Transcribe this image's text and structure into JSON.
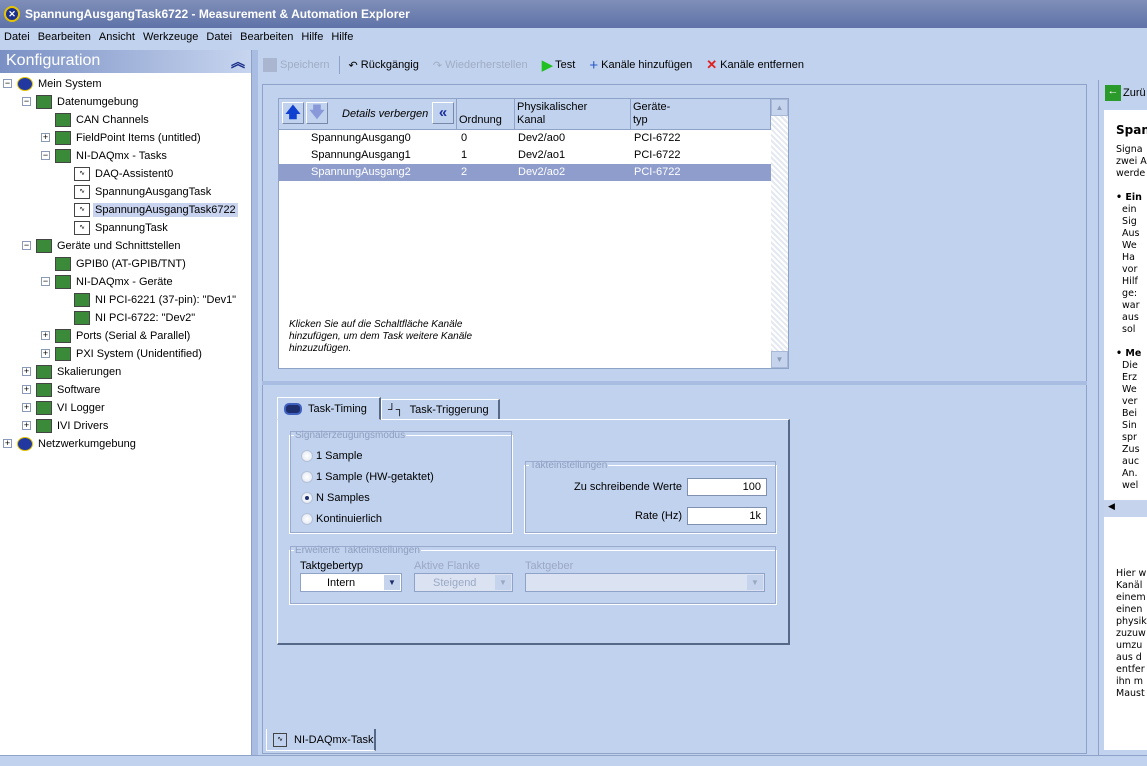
{
  "window": {
    "title": "SpannungAusgangTask6722 - Measurement & Automation Explorer"
  },
  "menu": [
    "Datei",
    "Bearbeiten",
    "Ansicht",
    "Werkzeuge",
    "Datei",
    "Bearbeiten",
    "Hilfe",
    "Hilfe"
  ],
  "left": {
    "title": "Konfiguration",
    "tree": [
      {
        "label": "Mein System",
        "level": 0,
        "exp": "-",
        "icon": "computer-icon"
      },
      {
        "label": "Datenumgebung",
        "level": 1,
        "exp": "-",
        "icon": "data-neighborhood-icon"
      },
      {
        "label": "CAN Channels",
        "level": 2,
        "exp": "",
        "icon": "can-icon"
      },
      {
        "label": "FieldPoint Items (untitled)",
        "level": 2,
        "exp": "+",
        "icon": "fieldpoint-icon"
      },
      {
        "label": "NI-DAQmx - Tasks",
        "level": 2,
        "exp": "-",
        "icon": "tasks-folder-icon"
      },
      {
        "label": "DAQ-Assistent0",
        "level": 3,
        "exp": "",
        "icon": "task-icon"
      },
      {
        "label": "SpannungAusgangTask",
        "level": 3,
        "exp": "",
        "icon": "task-icon"
      },
      {
        "label": "SpannungAusgangTask6722",
        "level": 3,
        "exp": "",
        "icon": "task-icon",
        "selected": true
      },
      {
        "label": "SpannungTask",
        "level": 3,
        "exp": "",
        "icon": "task-icon"
      },
      {
        "label": "Geräte und Schnittstellen",
        "level": 1,
        "exp": "-",
        "icon": "devices-icon"
      },
      {
        "label": "GPIB0 (AT-GPIB/TNT)",
        "level": 2,
        "exp": "",
        "icon": "gpib-icon"
      },
      {
        "label": "NI-DAQmx - Geräte",
        "level": 2,
        "exp": "-",
        "icon": "daq-devices-icon"
      },
      {
        "label": "NI PCI-6221 (37-pin): \"Dev1\"",
        "level": 3,
        "exp": "",
        "icon": "device-icon"
      },
      {
        "label": "NI PCI-6722: \"Dev2\"",
        "level": 3,
        "exp": "",
        "icon": "device-icon"
      },
      {
        "label": "Ports (Serial & Parallel)",
        "level": 2,
        "exp": "+",
        "icon": "port-icon"
      },
      {
        "label": "PXI System (Unidentified)",
        "level": 2,
        "exp": "+",
        "icon": "pxi-icon"
      },
      {
        "label": "Skalierungen",
        "level": 1,
        "exp": "+",
        "icon": "scales-icon"
      },
      {
        "label": "Software",
        "level": 1,
        "exp": "+",
        "icon": "software-icon"
      },
      {
        "label": "VI Logger",
        "level": 1,
        "exp": "+",
        "icon": "vi-logger-icon"
      },
      {
        "label": "IVI Drivers",
        "level": 1,
        "exp": "+",
        "icon": "ivi-icon"
      },
      {
        "label": "Netzwerkumgebung",
        "level": 0,
        "exp": "+",
        "icon": "network-icon"
      }
    ]
  },
  "toolbar": {
    "save": "Speichern",
    "undo": "Rückgängig",
    "redo": "Wiederherstellen",
    "test": "Test",
    "add": "Kanäle hinzufügen",
    "remove": "Kanäle entfernen"
  },
  "channels": {
    "details": "Details verbergen",
    "headers": {
      "order": "Ordnung",
      "phys1": "Physikalischer",
      "phys2": "Kanal",
      "dev1": "Geräte-",
      "dev2": "typ"
    },
    "rows": [
      {
        "name": "SpannungAusgang0",
        "order": "0",
        "channel": "Dev2/ao0",
        "device": "PCI-6722"
      },
      {
        "name": "SpannungAusgang1",
        "order": "1",
        "channel": "Dev2/ao1",
        "device": "PCI-6722"
      },
      {
        "name": "SpannungAusgang2",
        "order": "2",
        "channel": "Dev2/ao2",
        "device": "PCI-6722",
        "selected": true
      }
    ],
    "hint": "Klicken Sie auf die Schaltfläche Kanäle hinzufügen, um dem Task weitere Kanäle hinzuzufügen."
  },
  "tabs": {
    "timing": "Task-Timing",
    "triggering": "Task-Triggerung"
  },
  "timing": {
    "mode_legend": "Signalerzeugungsmodus",
    "modes": [
      "1 Sample",
      "1 Sample (HW-getaktet)",
      "N Samples",
      "Kontinuierlich"
    ],
    "selected_mode": 2,
    "clock_legend": "Takteinstellungen",
    "samples_label": "Zu schreibende Werte",
    "samples": "100",
    "rate_label": "Rate (Hz)",
    "rate": "1k",
    "adv_legend": "Erweiterte Takteinstellungen",
    "clock_type_label": "Taktgebertyp",
    "clock_type": "Intern",
    "edge_label": "Aktive Flanke",
    "edge": "Steigend",
    "source_label": "Taktgeber",
    "source": ""
  },
  "bottom_tab": "NI-DAQmx-Task",
  "help": {
    "back": "Zurü",
    "title": "Span",
    "top_lines": [
      "Signa",
      "zwei A",
      "werde",
      "",
      "• Ein",
      "  ein",
      "  Sig",
      "  Aus",
      "  We",
      "  Ha",
      "  vor",
      "  Hilf",
      "  ge:",
      "  war",
      "  aus",
      "  sol",
      "",
      "• Me",
      "  Die",
      "  Erz",
      "  We",
      "  ver",
      "  Bei",
      "  Sin",
      "  spr",
      "  Zus",
      "  auc",
      "  An.",
      "  wel"
    ],
    "bottom_lines": [
      "Hier w",
      "Kanäl",
      "einem",
      "einen",
      "physik",
      "zuzuw",
      "umzu",
      "aus d",
      "entfer",
      "ihn m",
      "Maust"
    ]
  }
}
